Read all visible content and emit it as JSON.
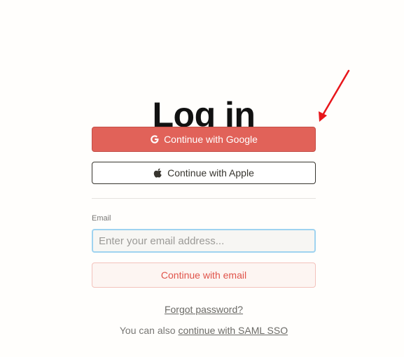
{
  "page": {
    "title": "Log in"
  },
  "buttons": {
    "google_label": "Continue with Google",
    "apple_label": "Continue with Apple",
    "email_label": "Continue with email"
  },
  "email": {
    "label": "Email",
    "placeholder": "Enter your email address...",
    "value": ""
  },
  "links": {
    "forgot_password": "Forgot password?",
    "saml_prefix": "You can also",
    "saml_link": "continue with SAML SSO"
  },
  "icons": {
    "google": "google-g-icon",
    "apple": "apple-icon",
    "annotation": "red-arrow"
  },
  "colors": {
    "google_button": "#e16259",
    "email_button_text": "#e0534a",
    "input_focus_border": "#9fd3f0",
    "annotation_arrow": "#e8161b"
  }
}
